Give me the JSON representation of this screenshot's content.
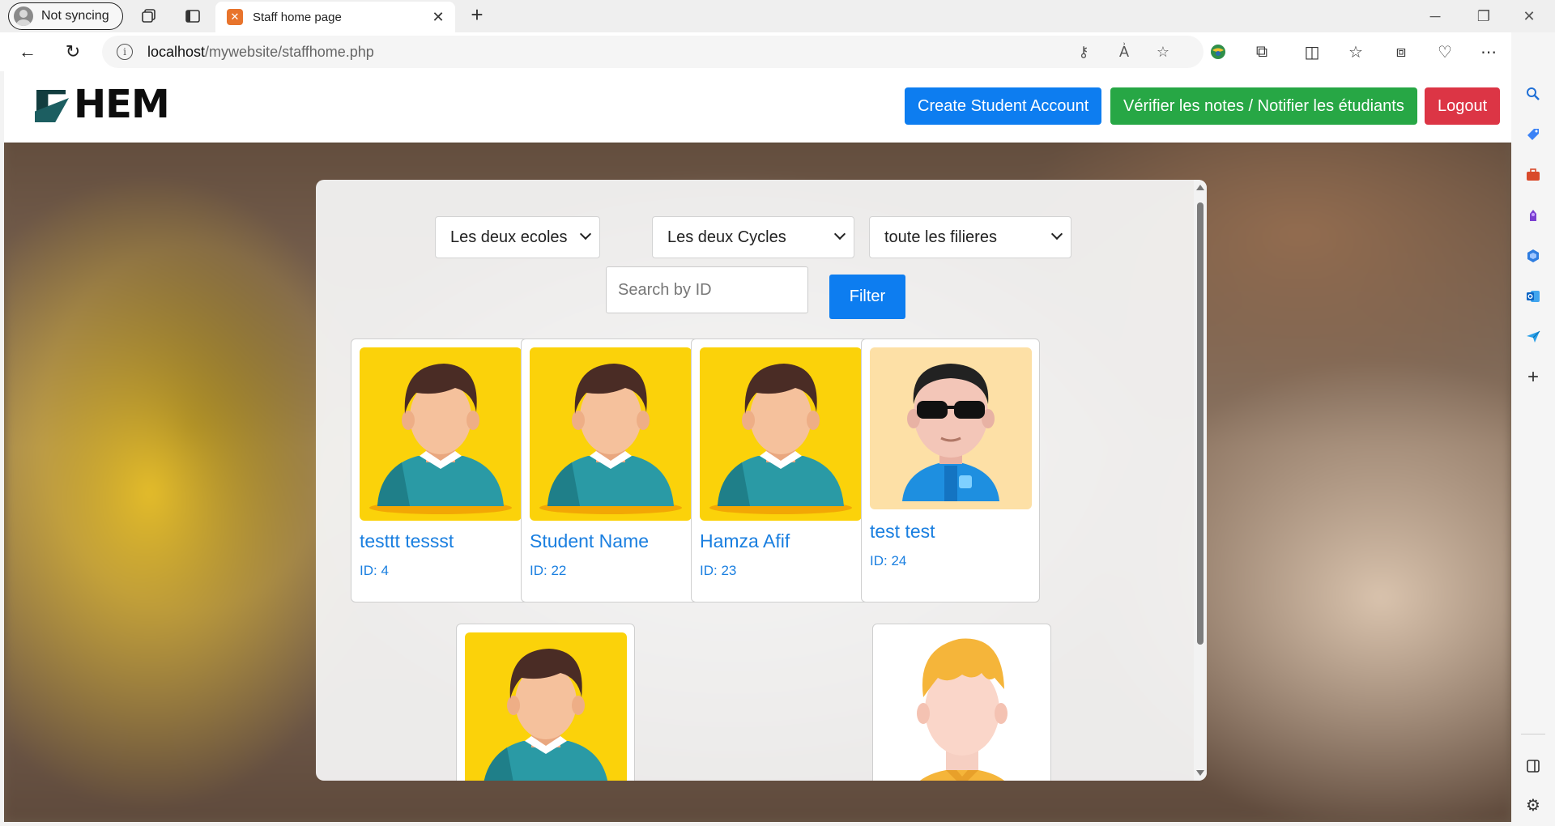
{
  "browser": {
    "profile_label": "Not syncing",
    "tab_title": "Staff home page",
    "url_host": "localhost",
    "url_path": "/mywebsite/staffhome.php"
  },
  "site": {
    "logo_text": "HEM",
    "buttons": {
      "create": "Create Student Account",
      "verify": "Vérifier les notes / Notifier les étudiants",
      "logout": "Logout"
    }
  },
  "filters": {
    "ecole": "Les deux ecoles",
    "cycle": "Les deux Cycles",
    "filiere": "toute les filieres",
    "search_placeholder": "Search by ID",
    "filter_label": "Filter"
  },
  "students": [
    {
      "name": "testtt tessst",
      "id_label": "ID: 4",
      "avatar": "male-avatar-icon"
    },
    {
      "name": "Student Name",
      "id_label": "ID: 22",
      "avatar": "male-avatar-icon"
    },
    {
      "name": "Hamza Afif",
      "id_label": "ID: 23",
      "avatar": "male-avatar-icon"
    },
    {
      "name": "test test",
      "id_label": "ID: 24",
      "avatar": "3d-avatar-sunglasses-icon"
    },
    {
      "name": "",
      "id_label": "",
      "avatar": "male-avatar-icon"
    },
    {
      "name": "",
      "id_label": "",
      "avatar": "blond-avatar-icon"
    }
  ],
  "colors": {
    "primary": "#0d7df0",
    "success": "#27a745",
    "danger": "#dc3545",
    "avatar_bg": "#fbd20a"
  }
}
